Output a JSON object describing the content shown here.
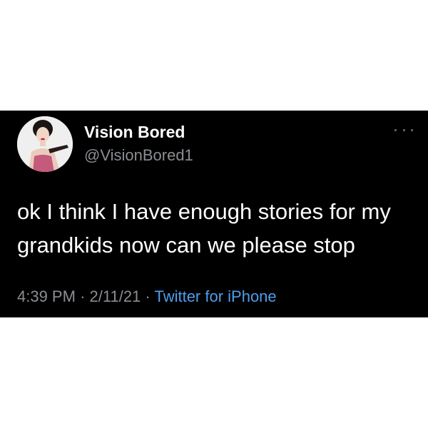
{
  "tweet": {
    "display_name": "Vision Bored",
    "handle": "@VisionBored1",
    "text": "ok I think I have enough stories for my grandkids now can we please stop",
    "time": "4:39 PM",
    "separator": "·",
    "date": "2/11/21",
    "source": "Twitter for iPhone",
    "more_icon": "more-horizontal-icon"
  },
  "colors": {
    "background": "#000000",
    "text": "#ffffff",
    "muted": "#8a8d91",
    "link": "#4d9fec"
  }
}
